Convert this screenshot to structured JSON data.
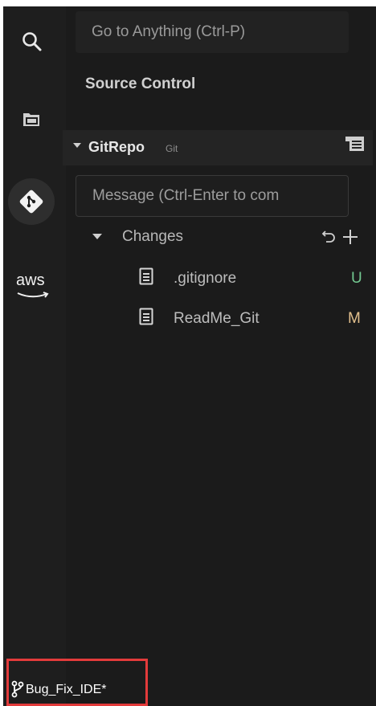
{
  "search": {
    "placeholder": "Go to Anything (Ctrl-P)"
  },
  "panel": {
    "title": "Source Control"
  },
  "repo": {
    "name": "GitRepo",
    "tag": "Git"
  },
  "commit": {
    "placeholder": "Message (Ctrl-Enter to com"
  },
  "changes": {
    "label": "Changes",
    "files": [
      {
        "name": ".gitignore",
        "status": "U",
        "status_color": "#73c991"
      },
      {
        "name": "ReadMe_Git",
        "status": "M",
        "status_color": "#e2c08d"
      }
    ]
  },
  "rail": {
    "aws_label": "aws"
  },
  "statusbar": {
    "branch": "Bug_Fix_IDE*"
  },
  "colors": {
    "highlight": "#e33b3b",
    "background": "#1c1c1c"
  }
}
